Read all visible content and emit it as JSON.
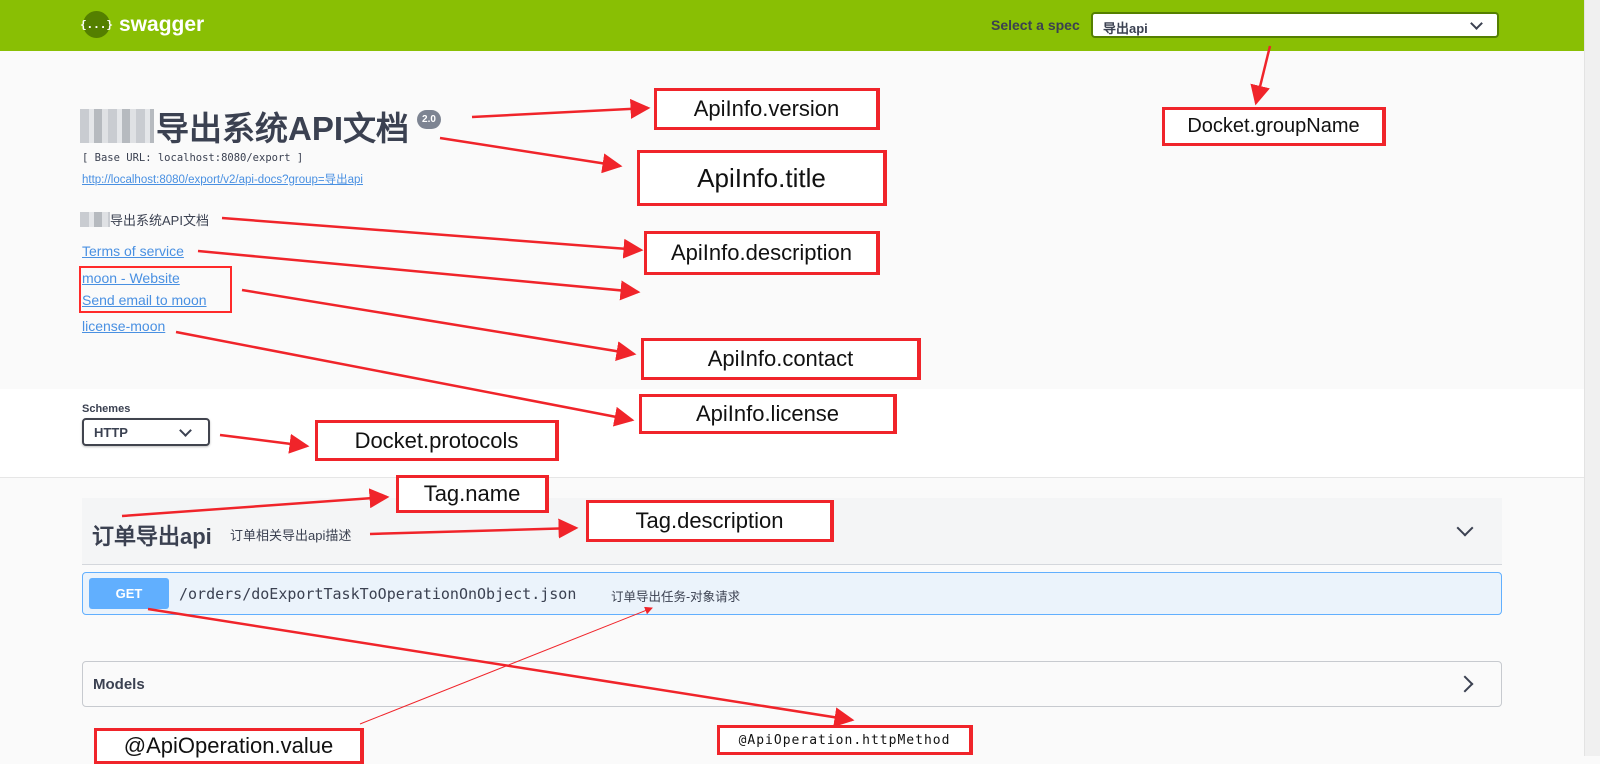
{
  "topbar": {
    "brand": "swagger",
    "logo_glyph": "{...}",
    "spec_label": "Select a spec",
    "spec_value": "导出api",
    "bg_color": "#89bf04"
  },
  "info": {
    "title": "导出系统API文档",
    "version": "2.0",
    "base_url": "[ Base URL: localhost:8080/export ]",
    "api_docs_link": "http://localhost:8080/export/v2/api-docs?group=导出api",
    "description": "导出系统API文档",
    "terms_link": "Terms of service",
    "contact_website": "moon - Website",
    "contact_email": "Send email to moon",
    "license_link": "license-moon"
  },
  "schemes": {
    "label": "Schemes",
    "selected": "HTTP"
  },
  "tag": {
    "name": "订单导出api",
    "description": "订单相关导出api描述"
  },
  "operation": {
    "method": "GET",
    "path": "/orders/doExportTaskToOperationOnObject.json",
    "summary": "订单导出任务-对象请求",
    "method_color": "#61affe"
  },
  "models": {
    "label": "Models"
  },
  "annotations": {
    "version": "ApiInfo.version",
    "group_name": "Docket.groupName",
    "title": "ApiInfo.title",
    "description": "ApiInfo.description",
    "contact": "ApiInfo.contact",
    "license": "ApiInfo.license",
    "protocols": "Docket.protocols",
    "tag_name": "Tag.name",
    "tag_description": "Tag.description",
    "operation_value": "@ApiOperation.value",
    "operation_method": "@ApiOperation.httpMethod",
    "color": "#f0242a"
  }
}
